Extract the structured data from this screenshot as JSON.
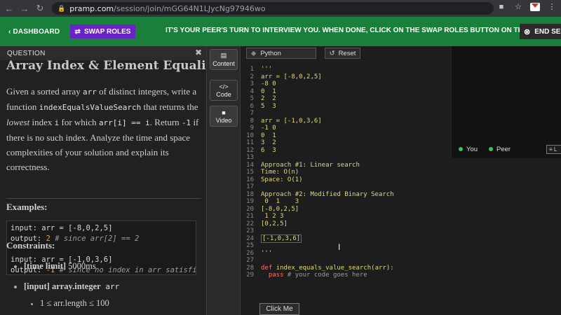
{
  "browser": {
    "url_domain": "pramp.com",
    "url_path": "/session/join/mGG64N1LJycNg97946wo"
  },
  "banner": {
    "dashboard": "‹ DASHBOARD",
    "swap_roles": "SWAP ROLES",
    "message": "IT'S YOUR PEER'S TURN TO INTERVIEW YOU. WHEN DONE, CLICK ON THE SWAP ROLES BUTTON ON THE LEFT",
    "end_session": "END SES",
    "color": "#1b7f3c",
    "swap_color": "#6a22c9"
  },
  "question": {
    "header": "QUESTION",
    "title": "Array Index & Element Equality",
    "body_1": "Given a sorted array",
    "body_arr": "arr",
    "body_2": "of distinct integers, write a function",
    "body_fn": "indexEqualsValueSearch",
    "body_3": "that returns the",
    "body_lowest": "lowest",
    "body_4": "index",
    "body_i": "i",
    "body_5": "for which",
    "body_cond": "arr[i] == i",
    "body_6": ". Return",
    "body_neg": "-1",
    "body_7": "if there is no such index. Analyze the time and space complexities of your solution and explain its correctness.",
    "examples_head": "Examples:",
    "examples": [
      {
        "input": "input: arr = [-8,0,2,5]",
        "out": "output: ",
        "val": "2",
        "comment": " # since arr[2] == 2"
      },
      {
        "input": "input: arr = [-1,0,3,6]",
        "out": "output: ",
        "val": "-1",
        "comment": " # since no index in arr satisfies"
      }
    ],
    "constraints_head": "Constraints:",
    "constraints": [
      {
        "bold": "[time limit]",
        "text": " 5000ms",
        "code": ""
      },
      {
        "bold": "[input] array.integer",
        "text": "",
        "code": " arr"
      },
      {
        "bold": "",
        "text": "1 ≤ arr.length ≤ 100",
        "code": ""
      }
    ]
  },
  "sidebar": {
    "content": "Content",
    "code": "Code",
    "video": "Video"
  },
  "editor": {
    "language": "Python",
    "reset": "Reset",
    "lines": [
      "'''",
      "arr = [-8,0,2,5]",
      "-8 0",
      "0  1",
      "2  2",
      "5  3",
      "",
      "arr = [-1,0,3,6]",
      "-1 0",
      "0  1",
      "3  2",
      "6  3",
      "",
      "Approach #1: Linear search",
      "Time: O(n)",
      "Space: O(1)",
      "",
      "Approach #2: Modified Binary Search",
      " 0  1    3",
      "[-8,0,2,5]",
      " 1 2 3",
      "[0,2,5]",
      "",
      "[-1,0,3,6]",
      "",
      "'''",
      "",
      "def index_equals_value_search(arr):",
      "  pass # your code goes here"
    ],
    "click_me": "Click Me"
  },
  "video": {
    "you": "You",
    "peer": "Peer",
    "menu": "≡ L"
  }
}
